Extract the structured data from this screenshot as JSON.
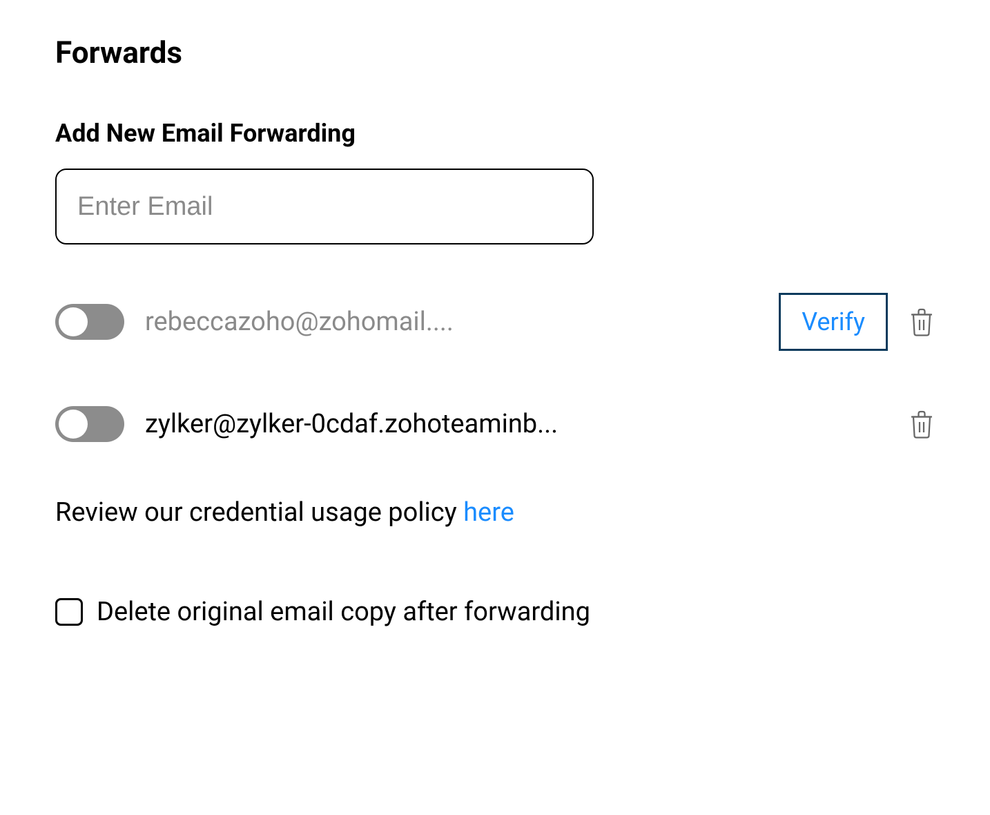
{
  "header": {
    "title": "Forwards"
  },
  "addSection": {
    "title": "Add New Email Forwarding",
    "placeholder": "Enter Email"
  },
  "forwards": [
    {
      "email": "rebeccazoho@zohomail....",
      "enabled": false,
      "needsVerification": true,
      "verifyLabel": "Verify"
    },
    {
      "email": "zylker@zylker-0cdaf.zohoteaminb...",
      "enabled": false,
      "needsVerification": false
    }
  ],
  "policy": {
    "prefix": "Review our credential usage policy ",
    "linkText": "here"
  },
  "deleteOption": {
    "label": "Delete original email copy after forwarding",
    "checked": false
  }
}
